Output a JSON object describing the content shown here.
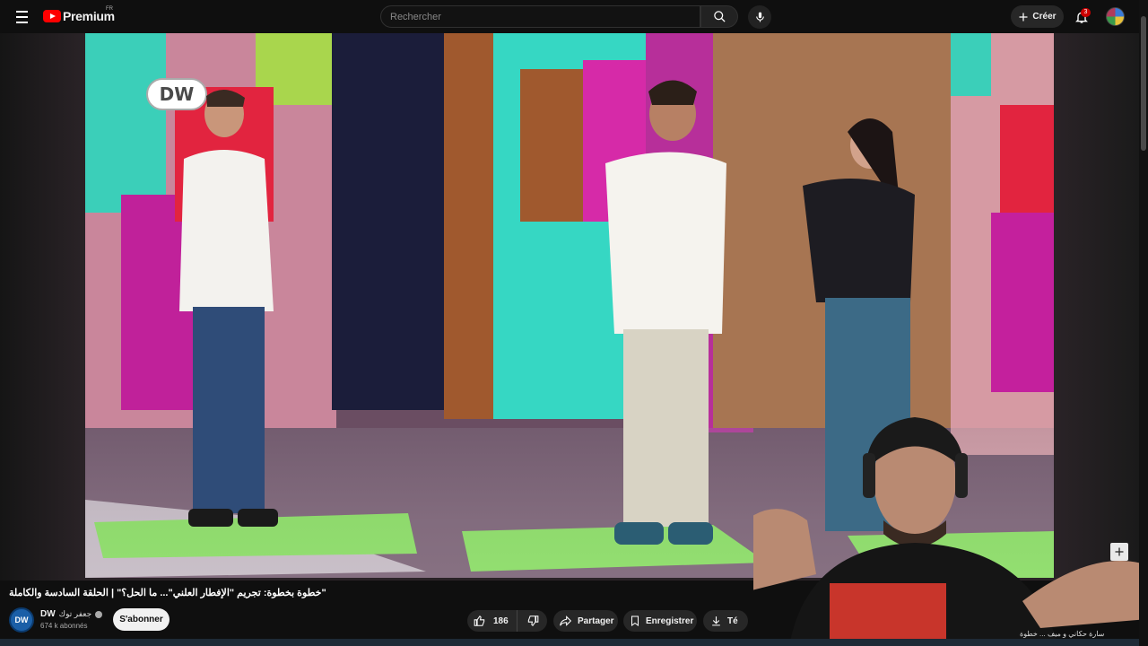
{
  "header": {
    "brand": "Premium",
    "region": "FR",
    "search_placeholder": "Rechercher",
    "create_label": "Créer",
    "notifications_count": "3"
  },
  "video": {
    "overlay_logo": "DW",
    "title": "خطوة بخطوة: تجريم \"الإفطار العلني\"... ما الحل؟\" | الحلقة السادسة والكاملة\""
  },
  "channel": {
    "avatar_text": "DW",
    "name": "DW",
    "name_arabic": "جعفر توك",
    "subscribers": "674 k abonnés",
    "subscribe_label": "S'abonner"
  },
  "actions": {
    "likes": "186",
    "share_label": "Partager",
    "save_label": "Enregistrer",
    "download_label": "Té"
  },
  "description_snippet": "سارة حكاني و ميف ... خطوة"
}
